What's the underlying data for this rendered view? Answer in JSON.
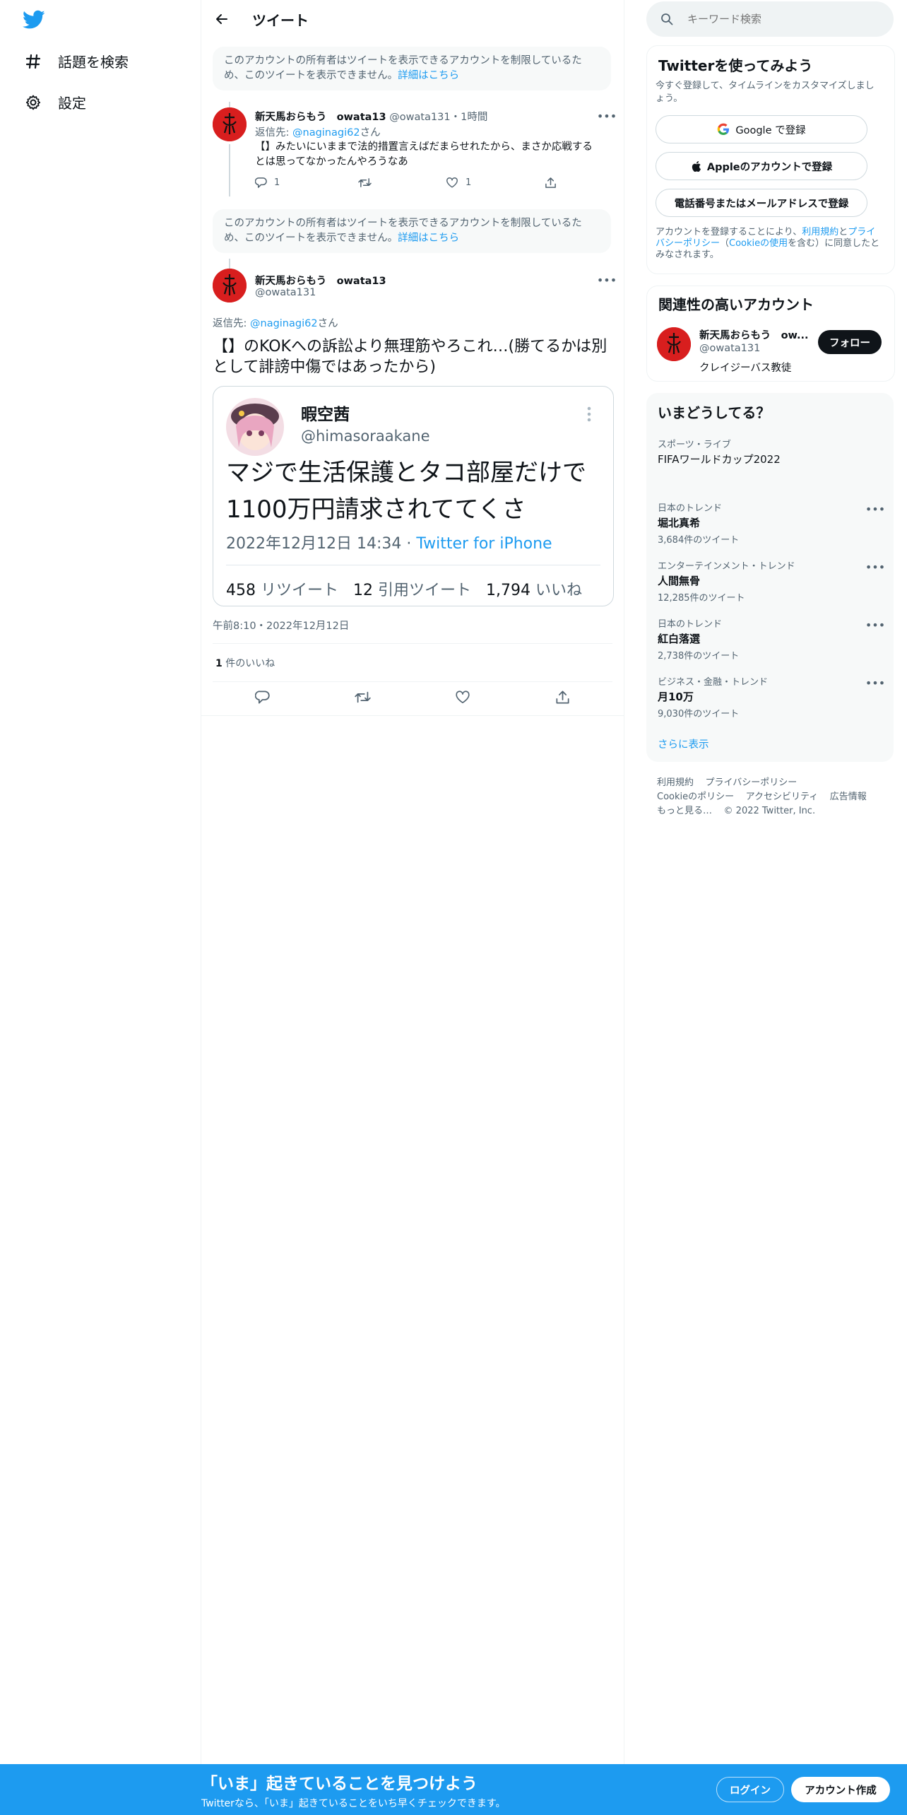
{
  "nav": {
    "explore": "話題を検索",
    "settings": "設定"
  },
  "header": {
    "title": "ツイート"
  },
  "restricted1": {
    "text": "このアカウントの所有者はツイートを表示できるアカウントを制限しているため、このツイートを表示できません。",
    "link": "詳細はこちら"
  },
  "reply_tweet": {
    "display_name": "新天馬おらもう　owata13",
    "handle": "@owata131",
    "time": "・1時間",
    "reply_prefix": "返信先: ",
    "reply_to": "@naginagi62",
    "reply_suffix": "さん",
    "text": "【】みたいにいままで法的措置言えばだまらせれたから、まさか応戦するとは思ってなかったんやろうなあ",
    "replies": "1",
    "retweets": "",
    "likes": "1"
  },
  "restricted2": {
    "text": "このアカウントの所有者はツイートを表示できるアカウントを制限しているため、このツイートを表示できません。",
    "link": "詳細はこちら"
  },
  "main_tweet": {
    "display_name": "新天馬おらもう　owata13",
    "handle": "@owata131",
    "reply_prefix": "返信先: ",
    "reply_to": "@naginagi62",
    "reply_suffix": "さん",
    "text": "【】のKOKへの訴訟より無理筋やろこれ…(勝てるかは別として誹謗中傷ではあったから)",
    "timestamp": "午前8:10・2022年12月12日",
    "like_count": "1",
    "like_label": " 件のいいね"
  },
  "embedded": {
    "name": "暇空茜",
    "handle": "@himasoraakane",
    "text": "マジで生活保護とタコ部屋だけで1100万円請求されててくさ",
    "date": "2022年12月12日 14:34 · ",
    "source": "Twitter for iPhone",
    "retweets_num": "458",
    "retweets_label": "リツイート",
    "quotes_num": "12",
    "quotes_label": "引用ツイート",
    "likes_num": "1,794",
    "likes_label": "いいね"
  },
  "search": {
    "placeholder": "キーワード検索"
  },
  "signup_panel": {
    "title": "Twitterを使ってみよう",
    "subtitle": "今すぐ登録して、タイムラインをカスタマイズしましょう。",
    "google": "Google で登録",
    "apple": "Appleのアカウントで登録",
    "phone": "電話番号またはメールアドレスで登録",
    "legal_1": "アカウントを登録することにより、",
    "legal_terms": "利用規約",
    "legal_2": "と",
    "legal_privacy": "プライバシーポリシー",
    "legal_3": "（",
    "legal_cookie": "Cookieの使用",
    "legal_4": "を含む）に同意したとみなされます。"
  },
  "related": {
    "title": "関連性の高いアカウント",
    "name": "新天馬おらもう　ow...",
    "handle": "@owata131",
    "bio": "クレイジーバス教徒",
    "follow": "フォロー"
  },
  "trends": {
    "title": "いまどうしてる？",
    "items": [
      {
        "category": "スポーツ・ライブ",
        "name": "FIFAワールドカップ2022",
        "count": ""
      },
      {
        "category": "日本のトレンド",
        "name": "堀北真希",
        "count": "3,684件のツイート"
      },
      {
        "category": "エンターテインメント・トレンド",
        "name": "人間無骨",
        "count": "12,285件のツイート"
      },
      {
        "category": "日本のトレンド",
        "name": "紅白落選",
        "count": "2,738件のツイート"
      },
      {
        "category": "ビジネス・金融・トレンド",
        "name": "月10万",
        "count": "9,030件のツイート"
      }
    ],
    "show_more": "さらに表示"
  },
  "footer": {
    "terms": "利用規約",
    "privacy": "プライバシーポリシー",
    "cookie": "Cookieのポリシー",
    "accessibility": "アクセシビリティ",
    "ads": "広告情報",
    "more": "もっと見る…",
    "copyright": "© 2022 Twitter, Inc."
  },
  "bottom_bar": {
    "title": "「いま」起きていることを見つけよう",
    "subtitle": "Twitterなら、「いま」起きていることをいち早くチェックできます。",
    "login": "ログイン",
    "signup": "アカウント作成"
  },
  "colors": {
    "accent": "#1d9bf0",
    "text": "#0f1419",
    "muted": "#536471"
  }
}
